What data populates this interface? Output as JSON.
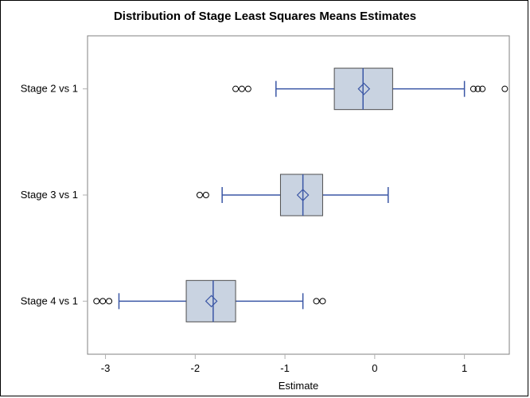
{
  "chart_data": {
    "type": "boxplot-horizontal",
    "title": "Distribution of Stage Least Squares Means Estimates",
    "xlabel": "Estimate",
    "ylabel": "",
    "xlim": [
      -3.2,
      1.5
    ],
    "x_ticks": [
      -3,
      -2,
      -1,
      0,
      1
    ],
    "categories": [
      "Stage 2 vs 1",
      "Stage 3 vs 1",
      "Stage 4 vs 1"
    ],
    "series": [
      {
        "name": "Stage 2 vs 1",
        "q1": -0.45,
        "median": -0.13,
        "q3": 0.2,
        "whisker_low": -1.1,
        "whisker_high": 1.0,
        "mean": -0.12,
        "outliers": [
          -1.55,
          -1.48,
          -1.41,
          1.1,
          1.15,
          1.2,
          1.45
        ]
      },
      {
        "name": "Stage 3 vs 1",
        "q1": -1.05,
        "median": -0.8,
        "q3": -0.58,
        "whisker_low": -1.7,
        "whisker_high": 0.15,
        "mean": -0.8,
        "outliers": [
          -1.95,
          -1.88
        ]
      },
      {
        "name": "Stage 4 vs 1",
        "q1": -2.1,
        "median": -1.8,
        "q3": -1.55,
        "whisker_low": -2.85,
        "whisker_high": -0.8,
        "mean": -1.82,
        "outliers": [
          -3.1,
          -3.03,
          -2.96,
          -0.65,
          -0.58
        ]
      }
    ]
  }
}
